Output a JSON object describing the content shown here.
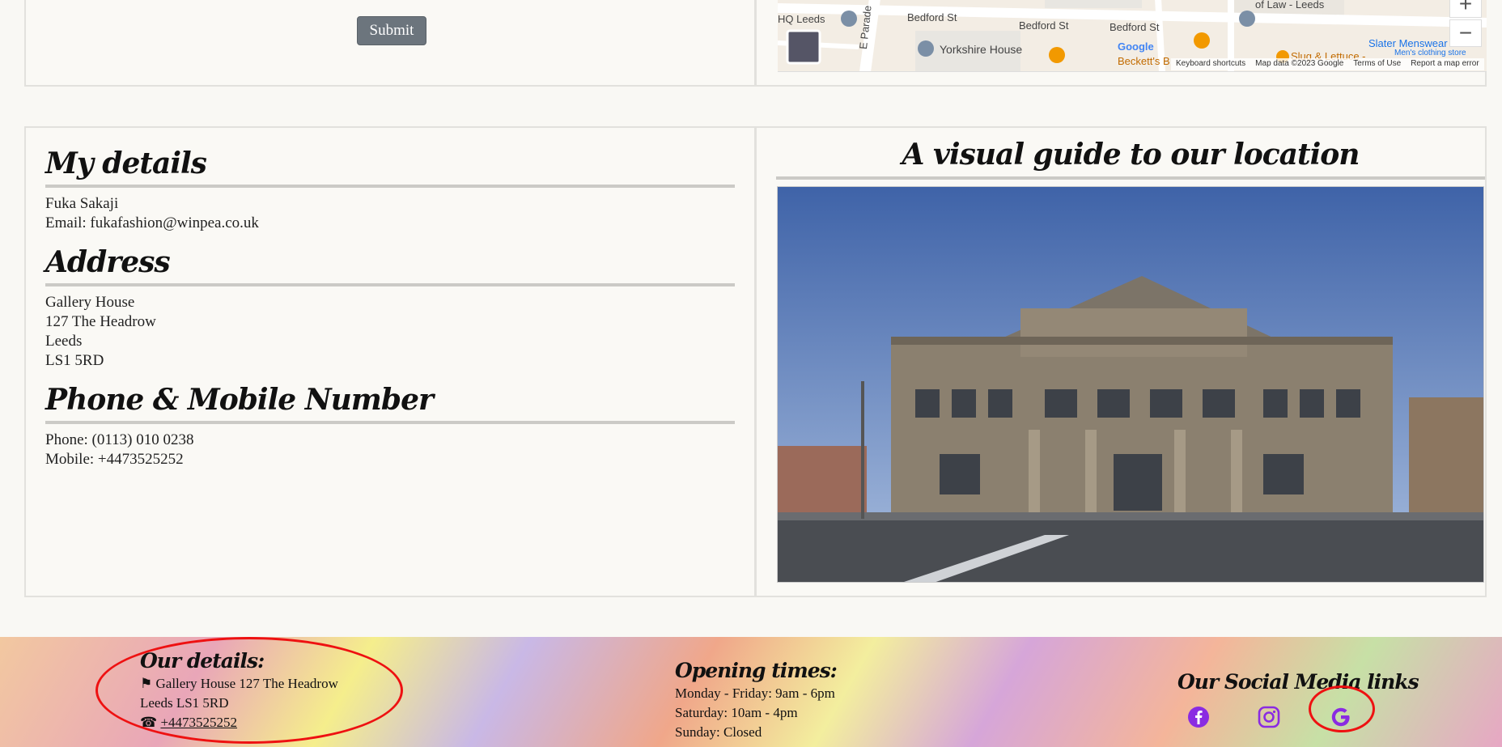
{
  "form": {
    "submit_label": "Submit"
  },
  "map": {
    "streets": [
      "Bedford St",
      "Bedford St",
      "Bedford St",
      "E Parade"
    ],
    "places": [
      "Yorkshire House",
      "Slater Menswear",
      "Men's clothing store",
      "of Law - Leeds",
      "Slug & Lettuce -",
      "Beckett's B",
      "HQ Leeds"
    ],
    "brand": "Google",
    "footer": [
      "Keyboard shortcuts",
      "Map data ©2023 Google",
      "Terms of Use",
      "Report a map error"
    ],
    "zoom_in": "+",
    "zoom_out": "−"
  },
  "details": {
    "my_details_heading": "My details",
    "name": "Fuka Sakaji",
    "email": "Email: fukafashion@winpea.co.uk",
    "address_heading": "Address",
    "address_lines": [
      "Gallery House",
      "127 The Headrow",
      "Leeds",
      "LS1 5RD"
    ],
    "phone_heading": "Phone & Mobile Number",
    "phone": "Phone: (0113) 010 0238",
    "mobile": "Mobile: +4473525252"
  },
  "guide": {
    "title": "A visual guide to our location"
  },
  "footer": {
    "details_heading": "Our details:",
    "address_line1": "Gallery House 127 The Headrow",
    "address_line2": "Leeds LS1 5RD",
    "phone": "+4473525252",
    "hours_heading": "Opening times:",
    "hours": [
      "Monday - Friday: 9am - 6pm",
      "Saturday: 10am - 4pm",
      "Sunday: Closed"
    ],
    "social_heading": "Our Social Media links",
    "social_icons": [
      "facebook-icon",
      "instagram-icon",
      "google-icon"
    ],
    "icon_color": "#8a2be2",
    "annotation_color": "#e11111"
  }
}
